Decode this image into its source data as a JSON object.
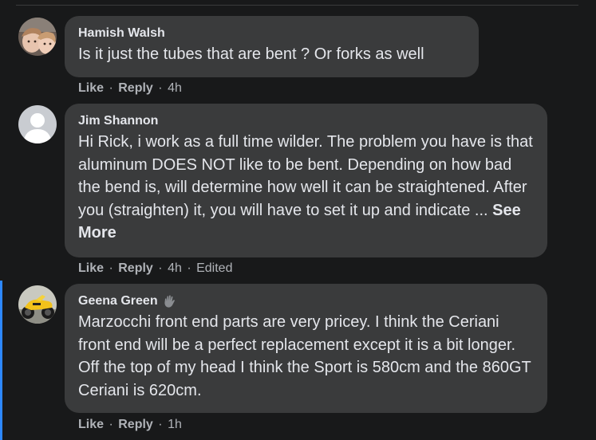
{
  "ui": {
    "bg": "#18191a",
    "bubble_bg": "#3a3b3c",
    "text_primary": "#e4e6eb",
    "text_secondary": "#b0b3b8",
    "thread_accent": "#2d88ff"
  },
  "comments": [
    {
      "author": "Hamish Walsh",
      "text": "Is it just the tubes that are bent ? Or forks as well",
      "like_label": "Like",
      "reply_label": "Reply",
      "separator": "·",
      "time": "4h",
      "avatar": "child-photo-avatar"
    },
    {
      "author": "Jim Shannon",
      "text": "Hi Rick, i work as a full time wilder. The problem you have is that aluminum DOES NOT like to be bent. Depending on how bad the bend is, will determine how well it can be straightened. After you (straighten) it, you will have to set it up and indicate ...",
      "see_more": "See More",
      "like_label": "Like",
      "reply_label": "Reply",
      "separator": "·",
      "time": "4h",
      "edited": "Edited",
      "avatar": "default-person-avatar"
    },
    {
      "author": "Geena Green",
      "badge": "waving-hand-icon",
      "text": "Marzocchi front end parts are very pricey. I think the Ceriani front end will be a perfect replacement except it is a bit longer. Off the top of my head I think the Sport is 580cm and the 860GT Ceriani is 620cm.",
      "like_label": "Like",
      "reply_label": "Reply",
      "separator": "·",
      "time": "1h",
      "avatar": "yellow-motorcycle-avatar"
    }
  ]
}
